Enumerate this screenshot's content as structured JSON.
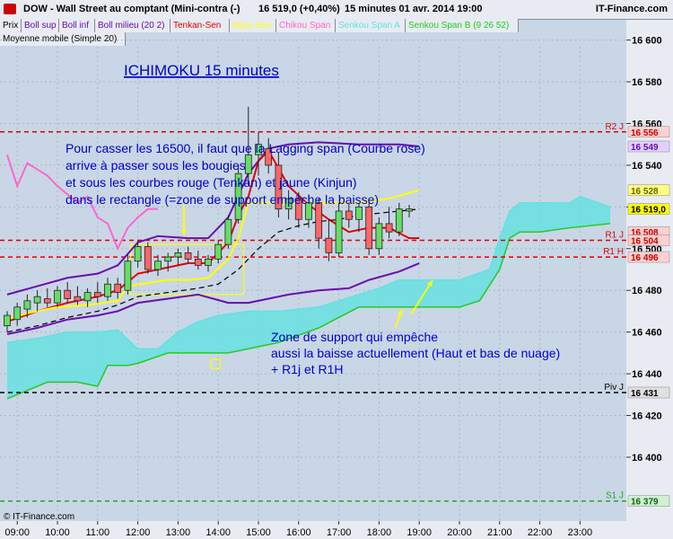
{
  "header": {
    "instrument": "DOW - Wall Street au comptant (Mini-contra (-)",
    "price_change": "16 519,0 (+0,40%)",
    "period_date": "15 minutes  01 avr. 2014 19:00",
    "source": "IT-Finance.com"
  },
  "legend": [
    {
      "label": "Prix",
      "color": "#000000",
      "bg": "#e8ecf2"
    },
    {
      "label": "Boll sup",
      "color": "#6a0dad",
      "bg": "#e8ecf2"
    },
    {
      "label": "Boll inf",
      "color": "#6a0dad",
      "bg": "#e8ecf2"
    },
    {
      "label": "Boll milieu (20 2)",
      "color": "#6a0dad",
      "bg": "#e8ecf2"
    },
    {
      "label": "Tenkan-Sen",
      "color": "#e00000",
      "bg": "#e8ecf2"
    },
    {
      "label": "Kijun-Sen",
      "color": "#ffff00",
      "bg": "#e8ecf2"
    },
    {
      "label": "Chikou Span",
      "color": "#ff66cc",
      "bg": "#e8ecf2"
    },
    {
      "label": "Senkou Span A",
      "color": "#66e0e0",
      "bg": "#e8ecf2"
    },
    {
      "label": "Senkou Span B (9 26 52)",
      "color": "#22cc22",
      "bg": "#e8ecf2"
    }
  ],
  "legend2": "Moyenne mobile (Simple 20)",
  "chart_data": {
    "type": "candlestick",
    "title": "ICHIMOKU 15 minutes",
    "ylim": [
      16375,
      16605
    ],
    "y_ticks": [
      "16 600",
      "16 580",
      "16 560",
      "16 540",
      "16 520",
      "16 500",
      "16 480",
      "16 460",
      "16 440",
      "16 420",
      "16 400"
    ],
    "y_tick_values": [
      16600,
      16580,
      16560,
      16540,
      16520,
      16500,
      16480,
      16460,
      16440,
      16420,
      16400
    ],
    "x_ticks": [
      "09:00",
      "10:00",
      "11:00",
      "12:00",
      "13:00",
      "14:00",
      "15:00",
      "16:00",
      "17:00",
      "18:00",
      "19:00",
      "20:00",
      "21:00",
      "22:00",
      "23:00"
    ],
    "x_range": [
      "08:45",
      "23:45"
    ],
    "candles": [
      {
        "t": "08:45",
        "o": 16463,
        "h": 16470,
        "l": 16460,
        "c": 16468
      },
      {
        "t": "09:00",
        "o": 16466,
        "h": 16474,
        "l": 16463,
        "c": 16472
      },
      {
        "t": "09:15",
        "o": 16471,
        "h": 16478,
        "l": 16467,
        "c": 16475
      },
      {
        "t": "09:30",
        "o": 16474,
        "h": 16480,
        "l": 16470,
        "c": 16477
      },
      {
        "t": "09:45",
        "o": 16476,
        "h": 16481,
        "l": 16472,
        "c": 16474
      },
      {
        "t": "10:00",
        "o": 16474,
        "h": 16482,
        "l": 16472,
        "c": 16480
      },
      {
        "t": "10:15",
        "o": 16480,
        "h": 16484,
        "l": 16474,
        "c": 16476
      },
      {
        "t": "10:30",
        "o": 16477,
        "h": 16482,
        "l": 16473,
        "c": 16475
      },
      {
        "t": "10:45",
        "o": 16475,
        "h": 16481,
        "l": 16472,
        "c": 16479
      },
      {
        "t": "11:00",
        "o": 16479,
        "h": 16484,
        "l": 16474,
        "c": 16477
      },
      {
        "t": "11:15",
        "o": 16477,
        "h": 16486,
        "l": 16475,
        "c": 16483
      },
      {
        "t": "11:30",
        "o": 16483,
        "h": 16486,
        "l": 16476,
        "c": 16479
      },
      {
        "t": "11:45",
        "o": 16480,
        "h": 16497,
        "l": 16478,
        "c": 16494
      },
      {
        "t": "12:00",
        "o": 16494,
        "h": 16504,
        "l": 16491,
        "c": 16501
      },
      {
        "t": "12:15",
        "o": 16501,
        "h": 16503,
        "l": 16488,
        "c": 16490
      },
      {
        "t": "12:30",
        "o": 16490,
        "h": 16497,
        "l": 16487,
        "c": 16494
      },
      {
        "t": "12:45",
        "o": 16494,
        "h": 16498,
        "l": 16489,
        "c": 16496
      },
      {
        "t": "13:00",
        "o": 16496,
        "h": 16500,
        "l": 16492,
        "c": 16498
      },
      {
        "t": "13:15",
        "o": 16498,
        "h": 16501,
        "l": 16493,
        "c": 16495
      },
      {
        "t": "13:30",
        "o": 16495,
        "h": 16499,
        "l": 16490,
        "c": 16492
      },
      {
        "t": "13:45",
        "o": 16492,
        "h": 16497,
        "l": 16489,
        "c": 16495
      },
      {
        "t": "14:00",
        "o": 16495,
        "h": 16504,
        "l": 16493,
        "c": 16502
      },
      {
        "t": "14:15",
        "o": 16502,
        "h": 16516,
        "l": 16500,
        "c": 16514
      },
      {
        "t": "14:30",
        "o": 16514,
        "h": 16540,
        "l": 16512,
        "c": 16536
      },
      {
        "t": "14:45",
        "o": 16536,
        "h": 16568,
        "l": 16530,
        "c": 16545
      },
      {
        "t": "15:00",
        "o": 16545,
        "h": 16556,
        "l": 16535,
        "c": 16550
      },
      {
        "t": "15:15",
        "o": 16548,
        "h": 16553,
        "l": 16536,
        "c": 16540
      },
      {
        "t": "15:30",
        "o": 16540,
        "h": 16546,
        "l": 16515,
        "c": 16519
      },
      {
        "t": "15:45",
        "o": 16519,
        "h": 16528,
        "l": 16514,
        "c": 16524
      },
      {
        "t": "16:00",
        "o": 16524,
        "h": 16527,
        "l": 16510,
        "c": 16514
      },
      {
        "t": "16:15",
        "o": 16514,
        "h": 16526,
        "l": 16510,
        "c": 16522
      },
      {
        "t": "16:30",
        "o": 16522,
        "h": 16524,
        "l": 16500,
        "c": 16505
      },
      {
        "t": "16:45",
        "o": 16505,
        "h": 16514,
        "l": 16494,
        "c": 16498
      },
      {
        "t": "17:00",
        "o": 16498,
        "h": 16522,
        "l": 16496,
        "c": 16518
      },
      {
        "t": "17:15",
        "o": 16518,
        "h": 16522,
        "l": 16510,
        "c": 16514
      },
      {
        "t": "17:30",
        "o": 16514,
        "h": 16522,
        "l": 16508,
        "c": 16520
      },
      {
        "t": "17:45",
        "o": 16520,
        "h": 16522,
        "l": 16497,
        "c": 16500
      },
      {
        "t": "18:00",
        "o": 16500,
        "h": 16515,
        "l": 16497,
        "c": 16512
      },
      {
        "t": "18:15",
        "o": 16512,
        "h": 16520,
        "l": 16505,
        "c": 16508
      },
      {
        "t": "18:30",
        "o": 16508,
        "h": 16522,
        "l": 16506,
        "c": 16519
      },
      {
        "t": "18:45",
        "o": 16518,
        "h": 16521,
        "l": 16515,
        "c": 16519
      }
    ],
    "series": [
      {
        "name": "Boll sup",
        "color": "#6a0dad",
        "points": [
          [
            "08:45",
            16478
          ],
          [
            "09:30",
            16482
          ],
          [
            "10:15",
            16486
          ],
          [
            "11:00",
            16488
          ],
          [
            "11:30",
            16492
          ],
          [
            "12:00",
            16503
          ],
          [
            "12:30",
            16506
          ],
          [
            "13:15",
            16505
          ],
          [
            "13:45",
            16505
          ],
          [
            "14:15",
            16515
          ],
          [
            "14:45",
            16536
          ],
          [
            "15:15",
            16548
          ],
          [
            "15:45",
            16550
          ],
          [
            "16:30",
            16551
          ],
          [
            "17:30",
            16550
          ],
          [
            "18:30",
            16550
          ],
          [
            "19:00",
            16549
          ]
        ]
      },
      {
        "name": "Boll inf",
        "color": "#6a0dad",
        "points": [
          [
            "08:45",
            16459
          ],
          [
            "09:30",
            16462
          ],
          [
            "10:15",
            16466
          ],
          [
            "11:00",
            16468
          ],
          [
            "11:30",
            16470
          ],
          [
            "12:00",
            16474
          ],
          [
            "12:45",
            16476
          ],
          [
            "13:30",
            16478
          ],
          [
            "14:15",
            16474
          ],
          [
            "14:45",
            16474
          ],
          [
            "15:15",
            16476
          ],
          [
            "15:45",
            16478
          ],
          [
            "16:30",
            16480
          ],
          [
            "17:15",
            16481
          ],
          [
            "17:45",
            16485
          ],
          [
            "18:30",
            16489
          ],
          [
            "19:00",
            16493
          ]
        ]
      },
      {
        "name": "Tenkan-Sen",
        "color": "#e00000",
        "points": [
          [
            "08:45",
            16465
          ],
          [
            "09:30",
            16470
          ],
          [
            "10:15",
            16474
          ],
          [
            "11:00",
            16477
          ],
          [
            "11:30",
            16480
          ],
          [
            "12:00",
            16488
          ],
          [
            "12:30",
            16490
          ],
          [
            "13:15",
            16493
          ],
          [
            "13:45",
            16493
          ],
          [
            "14:15",
            16503
          ],
          [
            "14:30",
            16516
          ],
          [
            "14:45",
            16525
          ],
          [
            "15:00",
            16542
          ],
          [
            "15:15",
            16547
          ],
          [
            "15:45",
            16530
          ],
          [
            "16:15",
            16521
          ],
          [
            "16:45",
            16514
          ],
          [
            "17:15",
            16508
          ],
          [
            "17:45",
            16510
          ],
          [
            "18:15",
            16510
          ],
          [
            "18:45",
            16505
          ],
          [
            "19:00",
            16505
          ]
        ]
      },
      {
        "name": "Kijun-Sen",
        "color": "#ffff00",
        "points": [
          [
            "08:45",
            16466
          ],
          [
            "09:15",
            16469
          ],
          [
            "10:00",
            16472
          ],
          [
            "10:45",
            16473
          ],
          [
            "11:30",
            16475
          ],
          [
            "11:45",
            16482
          ],
          [
            "12:45",
            16485
          ],
          [
            "13:15",
            16485
          ],
          [
            "13:45",
            16486
          ],
          [
            "14:15",
            16495
          ],
          [
            "14:30",
            16505
          ],
          [
            "14:45",
            16522
          ],
          [
            "15:45",
            16522
          ],
          [
            "16:30",
            16522
          ],
          [
            "17:30",
            16522
          ],
          [
            "18:15",
            16524
          ],
          [
            "19:00",
            16528
          ]
        ]
      },
      {
        "name": "Chikou Span",
        "color": "#ff66cc",
        "points": [
          [
            "08:45",
            16545
          ],
          [
            "09:00",
            16530
          ],
          [
            "09:15",
            16541
          ],
          [
            "09:30",
            16538
          ],
          [
            "09:45",
            16535
          ],
          [
            "10:00",
            16530
          ],
          [
            "10:30",
            16522
          ],
          [
            "10:45",
            16525
          ],
          [
            "11:00",
            16515
          ],
          [
            "11:15",
            16512
          ],
          [
            "11:30",
            16500
          ],
          [
            "11:45",
            16510
          ],
          [
            "12:00",
            16515
          ],
          [
            "12:15",
            16519
          ],
          [
            "12:30",
            16519
          ]
        ]
      },
      {
        "name": "Moyenne mobile (Simple 20)",
        "color": "#000000",
        "dashed": true,
        "points": [
          [
            "08:45",
            16460
          ],
          [
            "09:30",
            16463
          ],
          [
            "10:15",
            16467
          ],
          [
            "11:00",
            16470
          ],
          [
            "11:30",
            16473
          ],
          [
            "12:00",
            16477
          ],
          [
            "12:45",
            16479
          ],
          [
            "13:30",
            16481
          ],
          [
            "14:00",
            16483
          ],
          [
            "14:30",
            16490
          ],
          [
            "15:00",
            16500
          ],
          [
            "15:30",
            16508
          ],
          [
            "16:00",
            16511
          ],
          [
            "16:30",
            16513
          ],
          [
            "17:00",
            16514
          ],
          [
            "17:30",
            16516
          ],
          [
            "18:00",
            16517
          ],
          [
            "18:30",
            16518
          ],
          [
            "19:00",
            16519
          ]
        ]
      }
    ],
    "cloud": {
      "span_a": [
        [
          "08:45",
          16455
        ],
        [
          "09:30",
          16457
        ],
        [
          "10:15",
          16460
        ],
        [
          "11:00",
          16460
        ],
        [
          "11:30",
          16461
        ],
        [
          "12:00",
          16452
        ],
        [
          "12:30",
          16452
        ],
        [
          "13:00",
          16460
        ],
        [
          "13:30",
          16465
        ],
        [
          "14:00",
          16468
        ],
        [
          "14:45",
          16470
        ],
        [
          "15:30",
          16470
        ],
        [
          "16:30",
          16472
        ],
        [
          "17:30",
          16478
        ],
        [
          "18:00",
          16481
        ],
        [
          "18:30",
          16485
        ],
        [
          "19:00",
          16485
        ],
        [
          "20:00",
          16485
        ],
        [
          "20:45",
          16490
        ],
        [
          "21:00",
          16505
        ],
        [
          "21:15",
          16518
        ],
        [
          "21:30",
          16522
        ],
        [
          "22:00",
          16522
        ],
        [
          "22:45",
          16522
        ],
        [
          "23:00",
          16525
        ],
        [
          "23:45",
          16520
        ]
      ],
      "span_b": [
        [
          "08:45",
          16428
        ],
        [
          "09:15",
          16432
        ],
        [
          "09:45",
          16436
        ],
        [
          "10:30",
          16436
        ],
        [
          "11:00",
          16434
        ],
        [
          "11:15",
          16444
        ],
        [
          "11:45",
          16444
        ],
        [
          "12:00",
          16445
        ],
        [
          "12:45",
          16450
        ],
        [
          "13:30",
          16450
        ],
        [
          "14:15",
          16450
        ],
        [
          "14:45",
          16452
        ],
        [
          "15:30",
          16455
        ],
        [
          "16:30",
          16462
        ],
        [
          "17:30",
          16472
        ],
        [
          "18:00",
          16472
        ],
        [
          "18:30",
          16472
        ],
        [
          "19:00",
          16472
        ],
        [
          "20:00",
          16472
        ],
        [
          "20:30",
          16475
        ],
        [
          "21:00",
          16490
        ],
        [
          "21:15",
          16505
        ],
        [
          "21:30",
          16508
        ],
        [
          "22:00",
          16508
        ],
        [
          "22:45",
          16510
        ],
        [
          "23:45",
          16512
        ]
      ],
      "color_a": "#66e0e0",
      "color_b": "#22cc22"
    },
    "h_lines": [
      {
        "label": "R2 J",
        "value": 16556,
        "color": "#e00000"
      },
      {
        "label": "R1 J",
        "value": 16504,
        "color": "#e00000"
      },
      {
        "label": "R1 H",
        "value": 16496,
        "color": "#e00000"
      },
      {
        "label": "Piv J",
        "value": 16431,
        "color": "#000000"
      },
      {
        "label": "S1 J",
        "value": 16379,
        "color": "#22aa22"
      }
    ],
    "price_tags": [
      {
        "text": "16 556",
        "value": 16556,
        "bg": "#ffd0d0",
        "fg": "#cc0000"
      },
      {
        "text": "16 549",
        "value": 16549,
        "bg": "#e0d0ff",
        "fg": "#6a0dad"
      },
      {
        "text": "16 528",
        "value": 16528,
        "bg": "#ffff80",
        "fg": "#666600"
      },
      {
        "text": "16 519,0",
        "value": 16519,
        "bg": "#ffff00",
        "fg": "#000000"
      },
      {
        "text": "16 508",
        "value": 16508,
        "bg": "#ffd0d0",
        "fg": "#cc0000"
      },
      {
        "text": "16 504",
        "value": 16504,
        "bg": "#ffd0d0",
        "fg": "#cc0000"
      },
      {
        "text": "16 496",
        "value": 16496,
        "bg": "#ffd0d0",
        "fg": "#cc0000"
      },
      {
        "text": "16 431",
        "value": 16431,
        "bg": "#e0e0e0",
        "fg": "#000000"
      },
      {
        "text": "16 379",
        "value": 16379,
        "bg": "#d0f0d0",
        "fg": "#116611"
      }
    ],
    "rectangle": {
      "x0": "12:00",
      "x1": "14:30",
      "y0": 16478,
      "y1": 16502
    },
    "annotations": {
      "main": [
        "Pour casser les 16500, il faut que la Lagging span (Courbe rose)",
        "arrive à passer sous les bougies",
        "et sous les courbes rouge (Tenkan) et jaune (Kinjun)",
        "dans le rectangle (=zone de support empêche la baisse)"
      ],
      "zone": [
        "Zone de support qui empêche",
        "aussi la baisse actuellement (Haut et bas de nuage)",
        "+ R1j et R1H"
      ]
    },
    "copyright": "© IT-Finance.com",
    "grid": true
  }
}
